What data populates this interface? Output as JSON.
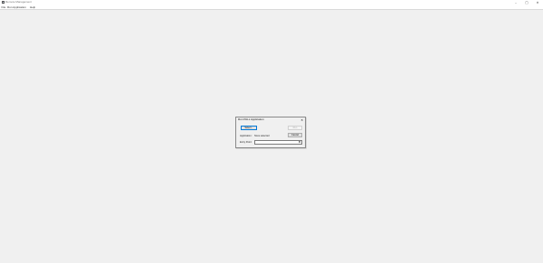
{
  "window": {
    "title": "Remote Management",
    "icon": "app-icon",
    "controls": {
      "minimize": "–",
      "maximize": "□",
      "close": "✕"
    }
  },
  "menu": {
    "file": "File",
    "run_application": "Run Application",
    "help": "Help"
  },
  "dialog": {
    "title": "Run PALL Application",
    "close": "✕",
    "select_button": "Select...",
    "run_button": "Run",
    "cancel_button": "Cancel",
    "application_label": "Application:",
    "application_value": "None selected",
    "entry_point_label": "Entry Point:",
    "entry_point_value": "",
    "dropdown_arrow": "▼"
  }
}
